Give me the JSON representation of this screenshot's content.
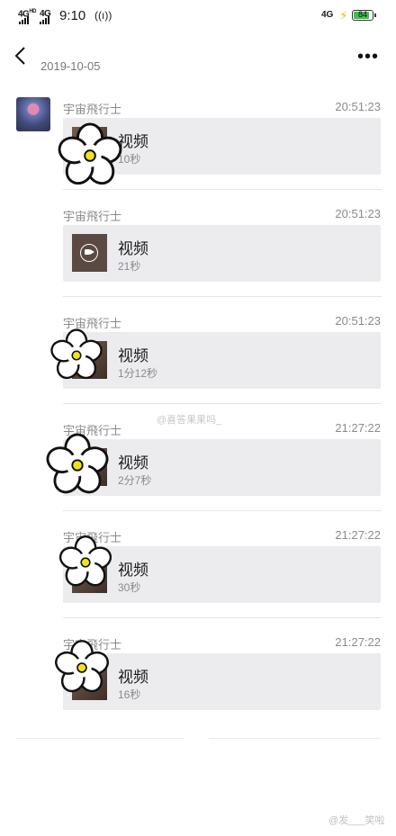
{
  "status_bar": {
    "net_left_1": "4G",
    "net_left_1_sup": "HD",
    "net_left_2": "4G",
    "time": "9:10",
    "net_right": "4G",
    "battery": "84"
  },
  "header": {
    "date": "2019-10-05",
    "more_label": "•••"
  },
  "messages": [
    {
      "sender": "宇宙飛行士",
      "time": "20:51:23",
      "title": "视频",
      "duration": "10秒"
    },
    {
      "sender": "宇宙飛行士",
      "time": "20:51:23",
      "title": "视频",
      "duration": "21秒"
    },
    {
      "sender": "宇宙飛行士",
      "time": "20:51:23",
      "title": "视频",
      "duration": "1分12秒"
    },
    {
      "sender": "宇宙飛行士",
      "time": "21:27:22",
      "title": "视频",
      "duration": "2分7秒"
    },
    {
      "sender": "宇宙飛行士",
      "time": "21:27:22",
      "title": "视频",
      "duration": "30秒"
    },
    {
      "sender": "宇宙飛行士",
      "time": "21:27:22",
      "title": "视频",
      "duration": "16秒"
    }
  ],
  "watermarks": {
    "mid": "@喜答果果吗_",
    "bottom": "@发___笑啦"
  },
  "colors": {
    "card_bg": "#ececef",
    "meta_text": "#8a8a8a",
    "battery_fill": "#3fbf4a"
  }
}
